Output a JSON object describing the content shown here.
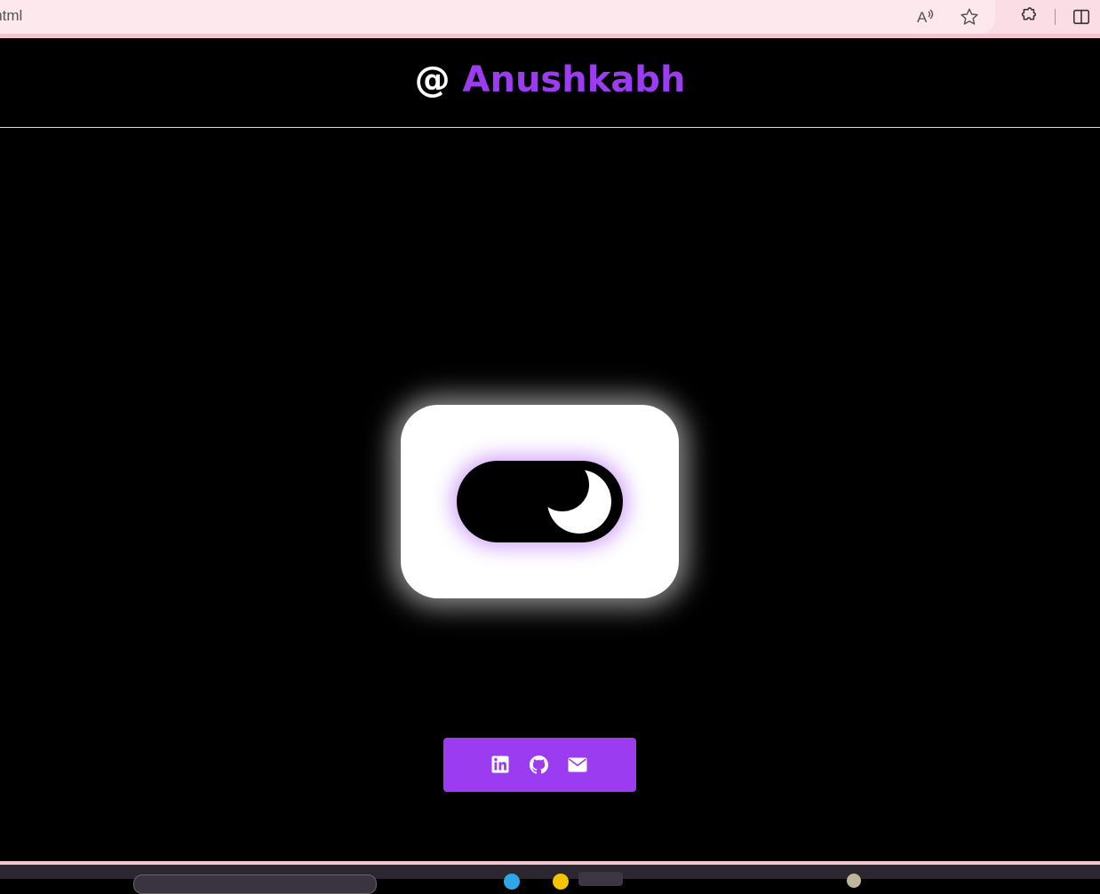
{
  "browser": {
    "url_text": "k.html",
    "icons": [
      "read-aloud-icon",
      "favorite-star-icon",
      "extensions-icon",
      "split-screen-icon"
    ]
  },
  "header": {
    "at_symbol": "@",
    "brand_name": "Anushkabh",
    "brand_color": "#9b3cf0"
  },
  "toggle": {
    "state": "dark",
    "icon": "moon-icon"
  },
  "socials": {
    "background": "#9b3cf0",
    "links": [
      "linkedin-icon",
      "github-icon",
      "email-icon"
    ]
  },
  "colors": {
    "page_background": "#000000",
    "accent": "#9b3cf0",
    "browser_bar": "#fbdde6"
  }
}
